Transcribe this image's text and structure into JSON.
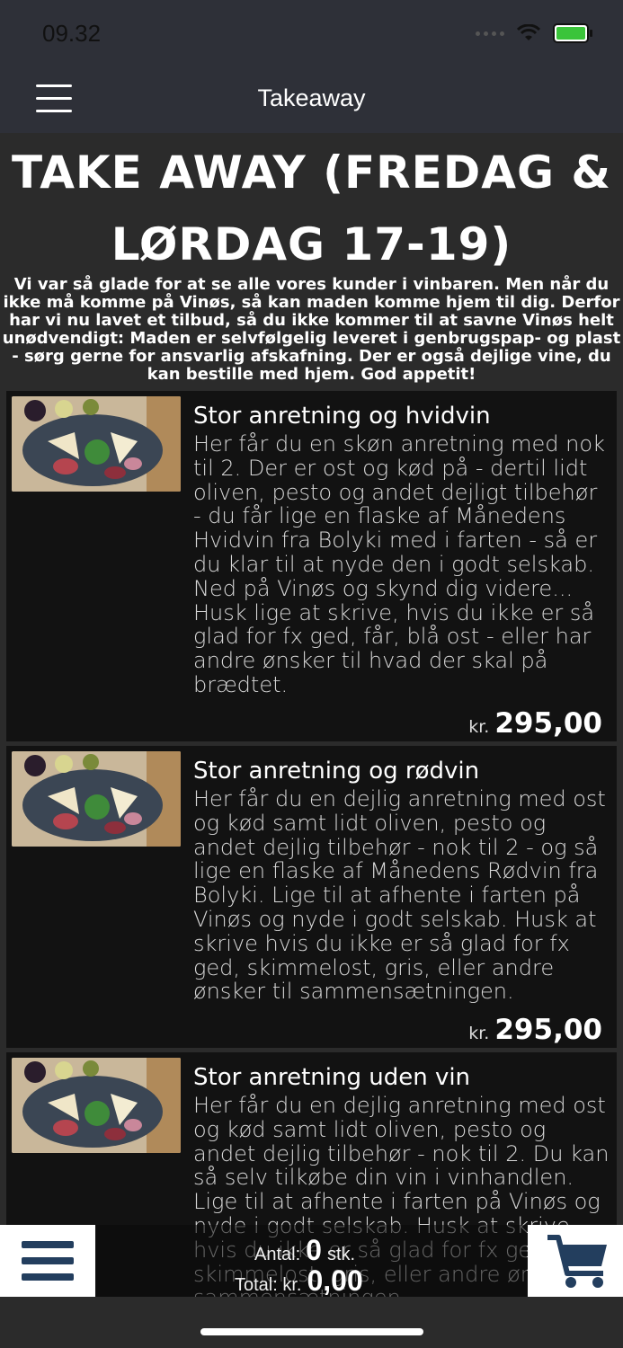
{
  "status_bar": {
    "time": "09.32"
  },
  "header": {
    "title": "Takeaway",
    "menu_icon": "hamburger-menu-icon"
  },
  "page": {
    "title_line1": "TAKE AWAY (FREDAG &",
    "title_line2": "LØRDAG 17-19)",
    "intro": "Vi var så glade for at se alle vores kunder i vinbaren. Men når du ikke må komme på Vinøs, så kan maden komme hjem til dig. Derfor har vi nu lavet et tilbud, så du ikke kommer til at savne Vinøs helt unødvendigt: Maden er selvfølgelig leveret i genbrugspap- og plast - sørg gerne for ansvarlig afskafning. Der er også dejlige vine, du kan bestille med hjem. God appetit!"
  },
  "products": [
    {
      "name": "Stor anretning og hvidvin",
      "description": "Her får du en skøn anretning med nok til 2. Der er ost og kød på - dertil lidt oliven, pesto og andet dejligt tilbehør - du får lige en flaske af Månedens Hvidvin fra Bolyki med i farten - så er du klar til at nyde den i godt selskab. Ned på Vinøs og skynd dig videre... Husk lige at skrive, hvis du ikke er så glad for fx ged, får, blå ost - eller har andre ønsker til hvad der skal på brædtet.",
      "currency": "kr.",
      "price": "295,00"
    },
    {
      "name": "Stor anretning og rødvin",
      "description": "Her får du en dejlig anretning med ost og kød samt lidt oliven, pesto og andet dejlig tilbehør - nok til 2 - og så lige en flaske af Månedens Rødvin fra Bolyki. Lige til at afhente i farten på Vinøs og nyde i godt selskab. Husk at skrive hvis du ikke er så glad for fx ged, skimmelost, gris, eller andre ønsker til sammensætningen.",
      "currency": "kr.",
      "price": "295,00"
    },
    {
      "name": "Stor anretning uden vin",
      "description": "Her får du en dejlig anretning med ost og kød samt lidt oliven, pesto og andet dejlig tilbehør - nok til 2. Du kan så selv tilkøbe din vin i vinhandlen. Lige til at afhente i farten på Vinøs og nyde i godt selskab. Husk at skrive hvis du ikke er så glad for fx ged, skimmelost, gris, eller andre ønsker til sammensætningen.",
      "currency": "kr.",
      "price": ""
    }
  ],
  "cart": {
    "count_label": "Antal:",
    "count": "0",
    "count_unit": "stk.",
    "total_label": "Total: kr.",
    "total": "0,00",
    "menu_icon": "list-menu-icon",
    "cart_icon": "shopping-cart-icon",
    "icon_color": "#233e5e"
  }
}
